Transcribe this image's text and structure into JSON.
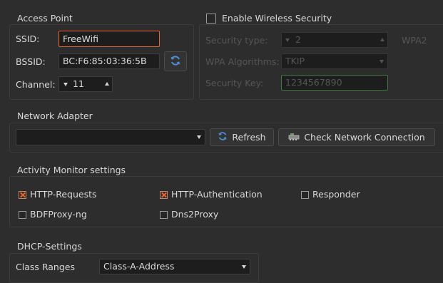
{
  "access_point": {
    "title": "Access Point",
    "ssid_label": "SSID:",
    "ssid_value": "FreeWifi",
    "bssid_label": "BSSID:",
    "bssid_value": "BC:F6:85:03:36:5B",
    "channel_label": "Channel:",
    "channel_value": "11"
  },
  "security": {
    "enable_label": "Enable Wireless Security",
    "enabled": false,
    "type_label": "Security type:",
    "type_value": "2",
    "type_suffix": "WPA2",
    "algorithms_label": "WPA Algorithms:",
    "algorithms_value": "TKIP",
    "key_label": "Security Key:",
    "key_value": "1234567890"
  },
  "network_adapter": {
    "title": "Network Adapter",
    "selected": "",
    "refresh_label": "Refresh",
    "check_label": "Check Network Connection"
  },
  "activity_monitor": {
    "title": "Activity Monitor settings",
    "items": [
      {
        "label": "HTTP-Requests",
        "checked": true
      },
      {
        "label": "HTTP-Authentication",
        "checked": true
      },
      {
        "label": "Responder",
        "checked": false
      },
      {
        "label": "BDFProxy-ng",
        "checked": false
      },
      {
        "label": "Dns2Proxy",
        "checked": false
      }
    ]
  },
  "dhcp": {
    "title": "DHCP-Settings",
    "class_ranges_label": "Class Ranges",
    "class_ranges_value": "Class-A-Address"
  },
  "colors": {
    "background": "#2d2d2d",
    "accent": "#e4662a",
    "refresh_icon": "#4a8fd8",
    "key_border": "#3a7a3a"
  }
}
